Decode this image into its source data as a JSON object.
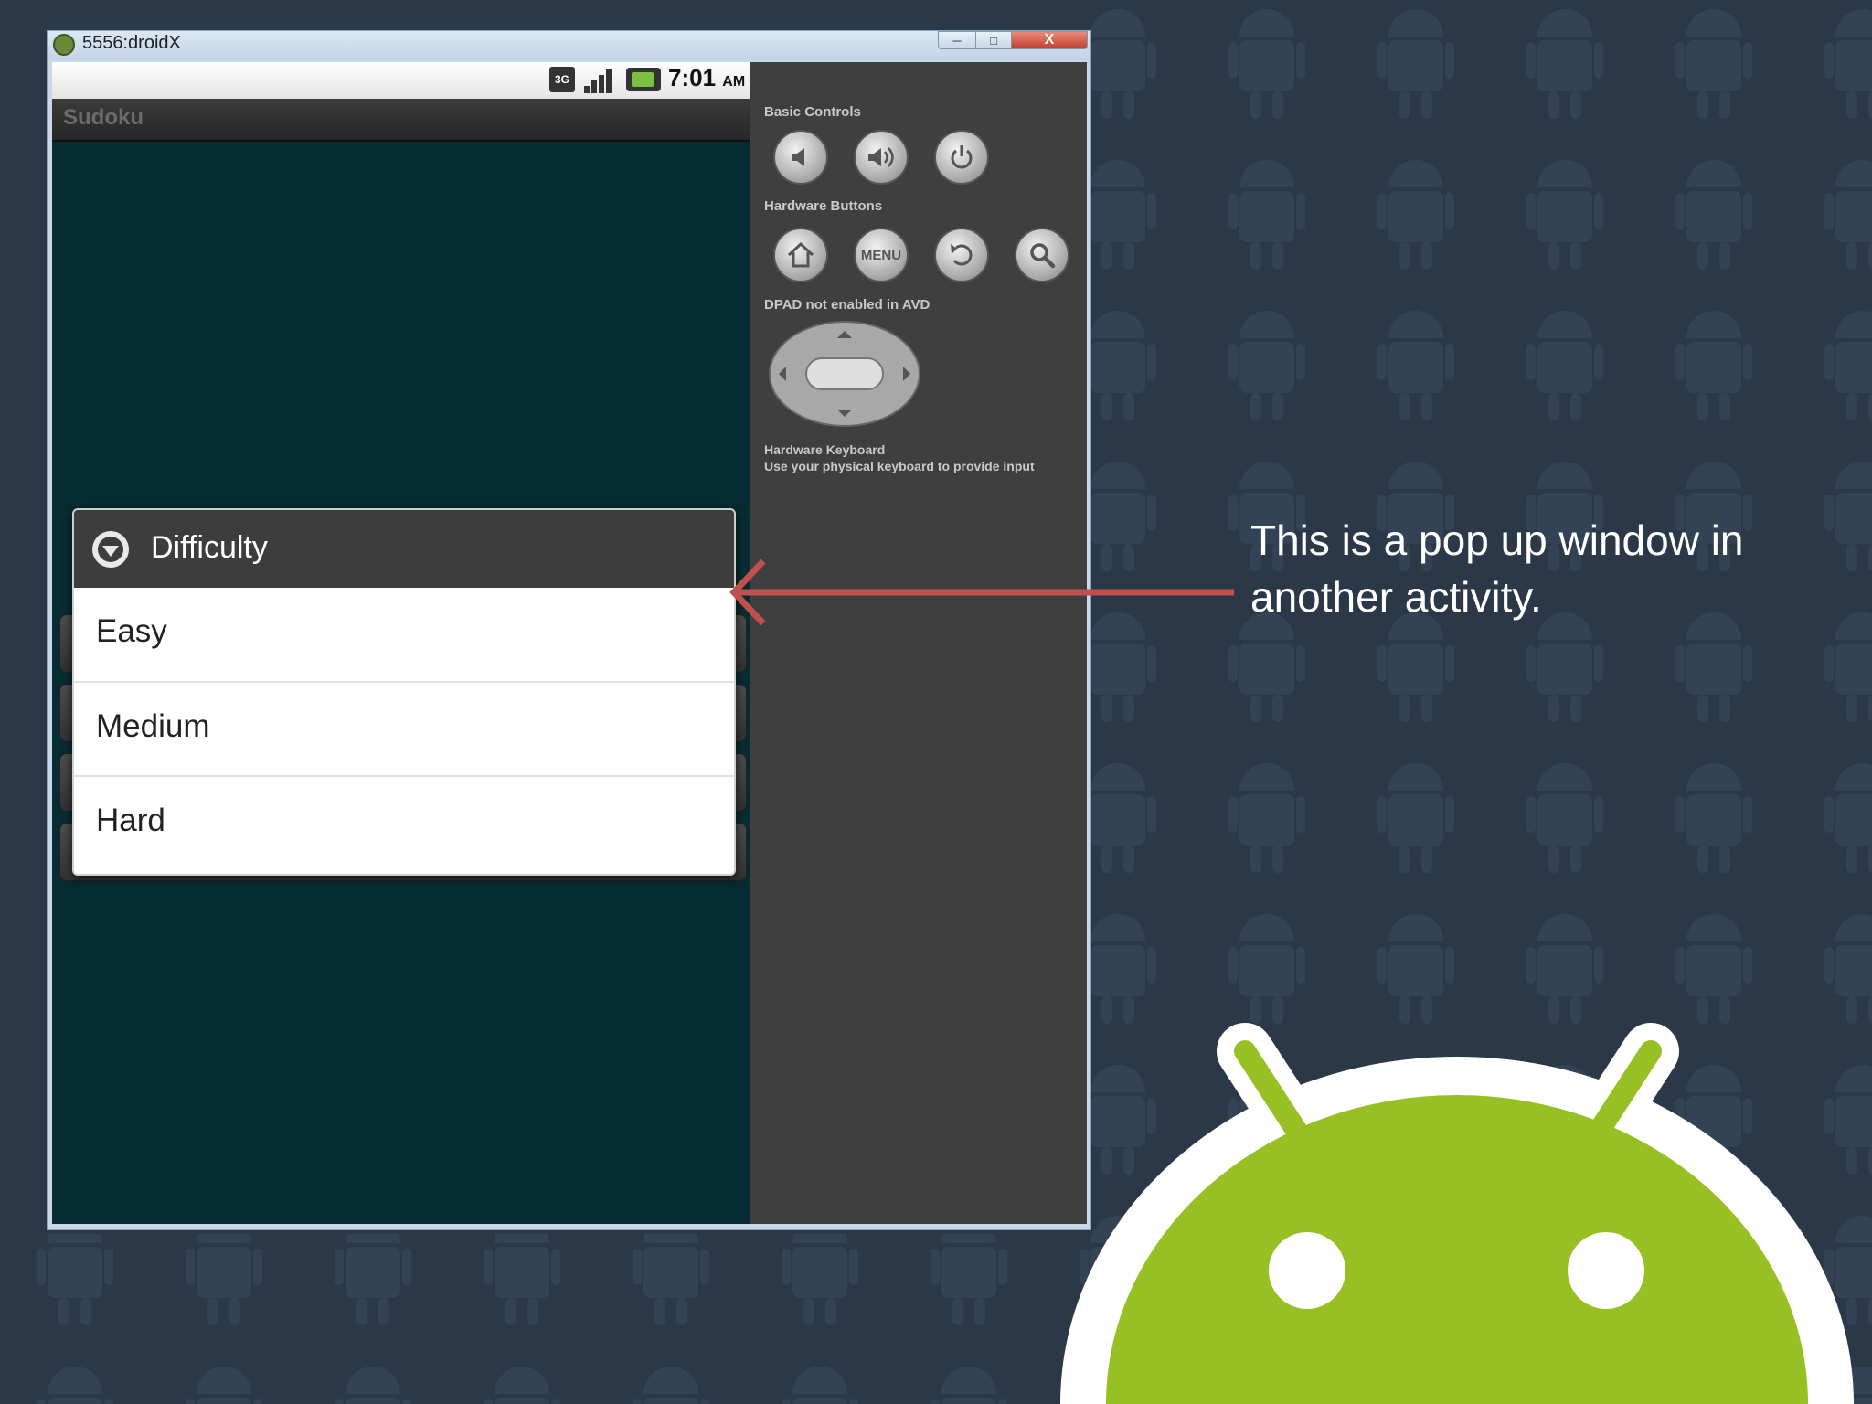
{
  "window": {
    "title": "5556:droidX",
    "minimize": "─",
    "maximize": "□",
    "close": "X"
  },
  "device": {
    "status_bar": {
      "network": "3G",
      "time": "7:01",
      "ampm": "AM"
    },
    "app_title": "Sudoku",
    "dialog": {
      "title": "Difficulty",
      "options": [
        "Easy",
        "Medium",
        "Hard"
      ]
    }
  },
  "controls": {
    "basic_controls_label": "Basic Controls",
    "hardware_buttons_label": "Hardware Buttons",
    "menu_label": "MENU",
    "dpad_label": "DPAD not enabled in AVD",
    "keyboard_label": "Hardware Keyboard",
    "keyboard_hint": "Use your physical keyboard to provide input"
  },
  "annotation": {
    "text": "This is a pop up window in another activity."
  },
  "colors": {
    "slide_background": "#2b3847",
    "device_background": "#062d33",
    "dialog_header": "#3d3d3d",
    "arrow": "#c0504d",
    "android_green": "#97c024"
  },
  "icons": [
    "volume-down-icon",
    "volume-up-icon",
    "power-icon",
    "home-icon",
    "back-icon",
    "search-icon",
    "dialog-dropdown-icon",
    "dpad-icon"
  ]
}
